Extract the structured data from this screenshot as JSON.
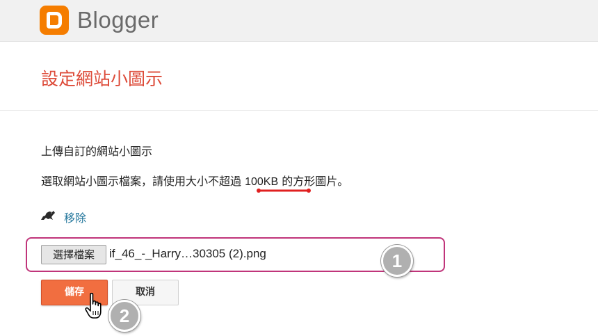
{
  "header": {
    "logo_text": "Blogger",
    "logo_color": "#f57d00"
  },
  "page": {
    "title": "設定網站小圖示",
    "title_color": "#dd4b39"
  },
  "content": {
    "upload_label": "上傳自訂的網站小圖示",
    "instruction_prefix": "選取網站小圖示檔案，請使用大小不超過 ",
    "instruction_size": "100KB",
    "instruction_suffix": " 的方形圖片。",
    "current_icon": "favicon-image-icon",
    "remove_link": "移除"
  },
  "file_input": {
    "button_label": "選擇檔案",
    "file_name": "if_46_-_Harry…30305 (2).png"
  },
  "actions": {
    "save_label": "儲存",
    "cancel_label": "取消",
    "save_color": "#f16e40"
  },
  "annotations": {
    "step1": "1",
    "step2": "2",
    "highlight_color": "#c0347a",
    "underline_color": "#e02020"
  }
}
